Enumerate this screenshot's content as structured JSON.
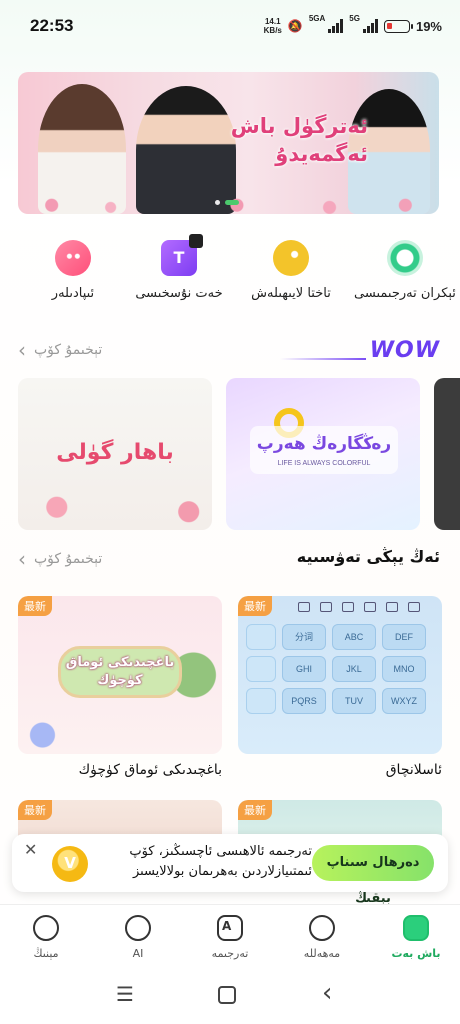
{
  "status_bar": {
    "time": "22:53",
    "speed_value": "14.1",
    "speed_unit": "KB/s",
    "net1": "5GA",
    "net2": "5G",
    "battery": "19%",
    "battery_color": "#e53935"
  },
  "banner": {
    "title": "ئەترگۈل باش ئەگمەيدۇ",
    "dots_total": 3,
    "dots_active": 2
  },
  "shortcuts": [
    {
      "label": "ئېكران تەرجىمىسى",
      "icon": "screen-translate-icon"
    },
    {
      "label": "تاختا لايىھىلەش",
      "icon": "palette-icon"
    },
    {
      "label": "خەت نۇسخىسى",
      "icon": "font-icon",
      "glyph": "T"
    },
    {
      "label": "ئىپادىلەر",
      "icon": "emoji-icon"
    }
  ],
  "wow_section": {
    "logo": "WOW",
    "more": "تېخىمۇ كۆپ",
    "cards": [
      {
        "title": "باھار گۈلى"
      },
      {
        "title": "رەڭگارەڭ ھەرپ",
        "subtitle": "LIFE IS ALWAYS COLORFUL"
      }
    ]
  },
  "new_section": {
    "title": "ئەڭ يېڭى تەۋسىيە",
    "more": "تېخىمۇ كۆپ",
    "badge": "最新",
    "themes": [
      {
        "name": "ئاسلانچاق"
      },
      {
        "name": "باغچىدىكى ئوماق كۈچۈك",
        "plaque": "باغچىدىكى ئوماق كۈچۈك"
      }
    ],
    "keyboard_keys": [
      "分词",
      "ABC",
      "DEF",
      "GHI",
      "JKL",
      "MNO",
      "PQRS",
      "TUV",
      "WXYZ"
    ]
  },
  "promo": {
    "text": "تەرجىمە ئالاھىسى ئاچسىڭىز، كۆپ ئىمتىيازلاردىن بەھرىمان بولالايسىز",
    "button": "دەرھال سىناپ بېقىڭ"
  },
  "tabs": [
    {
      "label": "باش بەت",
      "icon": "home-icon",
      "active": true
    },
    {
      "label": "مەھەللە",
      "icon": "planet-icon",
      "active": false
    },
    {
      "label": "تەرجىمە",
      "icon": "translate-icon",
      "active": false
    },
    {
      "label": "AI",
      "icon": "ai-icon",
      "active": false
    },
    {
      "label": "مېنىڭ",
      "icon": "profile-icon",
      "active": false
    }
  ],
  "colors": {
    "accent_green": "#2bcf7c",
    "badge_orange": "#f5a043",
    "wow_purple": "#6a3df0"
  }
}
